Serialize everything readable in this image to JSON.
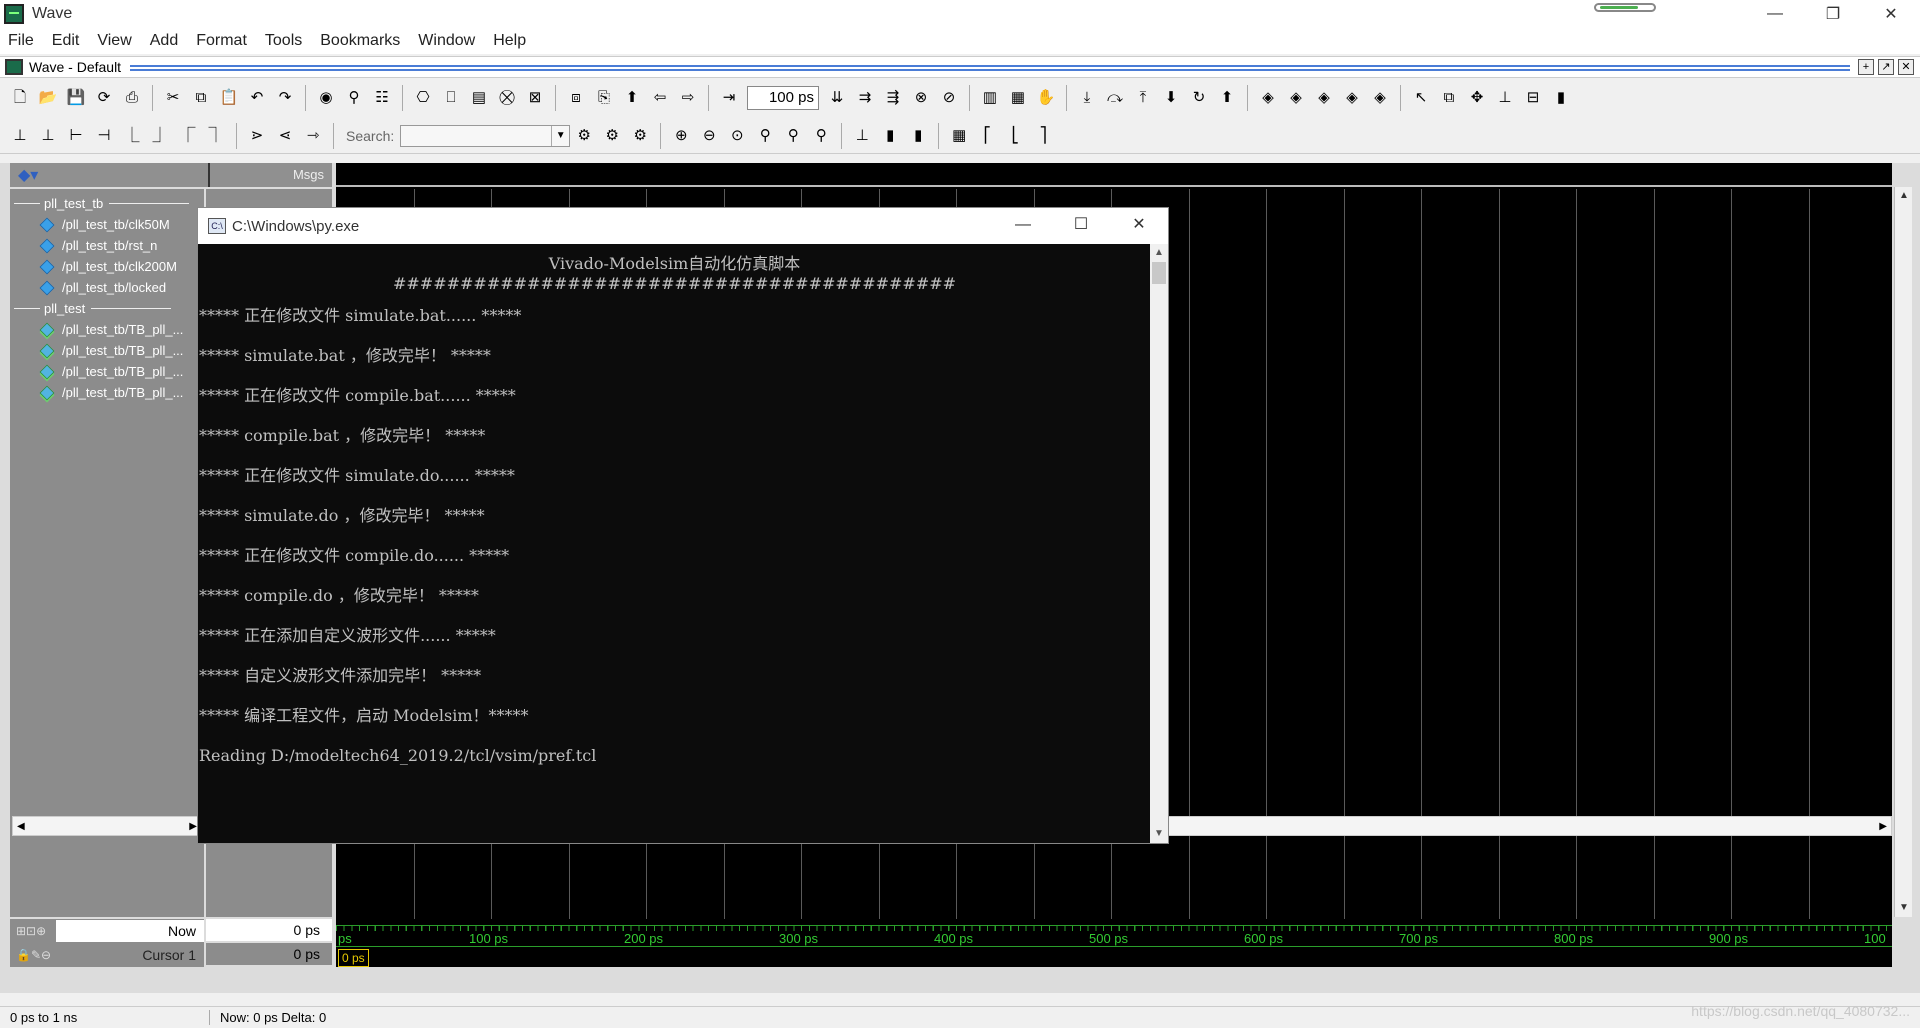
{
  "window": {
    "title": "Wave",
    "minimize": "—",
    "maximize": "❐",
    "close": "✕"
  },
  "menu": [
    "File",
    "Edit",
    "View",
    "Add",
    "Format",
    "Tools",
    "Bookmarks",
    "Window",
    "Help"
  ],
  "inner": {
    "title": "Wave - Default"
  },
  "toolbar": {
    "time_step": "100 ps",
    "search_label": "Search:",
    "search_value": ""
  },
  "signals": {
    "header_msgs": "Msgs",
    "groups": [
      {
        "label": "pll_test_tb",
        "items": [
          "/pll_test_tb/clk50M",
          "/pll_test_tb/rst_n",
          "/pll_test_tb/clk200M",
          "/pll_test_tb/locked"
        ]
      },
      {
        "label": "pll_test",
        "items": [
          "/pll_test_tb/TB_pll_...",
          "/pll_test_tb/TB_pll_...",
          "/pll_test_tb/TB_pll_...",
          "/pll_test_tb/TB_pll_..."
        ]
      }
    ]
  },
  "cursors": {
    "now_label": "Now",
    "now_value": "0 ps",
    "cursor_label": "Cursor 1",
    "cursor_value": "0 ps",
    "cursor_marker": "0 ps"
  },
  "timeline": {
    "labels": [
      "ps",
      "100 ps",
      "200 ps",
      "300 ps",
      "400 ps",
      "500 ps",
      "600 ps",
      "700 ps",
      "800 ps",
      "900 ps",
      "100"
    ]
  },
  "status": {
    "range": "0 ps to 1 ns",
    "now": "Now: 0 ps  Delta: 0",
    "watermark": "https://blog.csdn.net/qq_4080732..."
  },
  "console": {
    "title": "C:\\Windows\\py.exe",
    "heading": "Vivado-Modelsim自动化仿真脚本",
    "hashes": "##########################################",
    "lines": [
      "***** 正在修改文件 simulate.bat...... *****",
      "***** simulate.bat ，修改完毕！ *****",
      "***** 正在修改文件 compile.bat...... *****",
      "***** compile.bat ，修改完毕！ *****",
      "***** 正在修改文件 simulate.do...... *****",
      "***** simulate.do ，修改完毕！ *****",
      "***** 正在修改文件 compile.do...... *****",
      "***** compile.do ，修改完毕！ *****",
      "***** 正在添加自定义波形文件...... *****",
      "***** 自定义波形文件添加完毕！ *****",
      "***** 编译工程文件，启动 Modelsim！*****",
      "Reading D:/modeltech64_2019.2/tcl/vsim/pref.tcl"
    ]
  }
}
